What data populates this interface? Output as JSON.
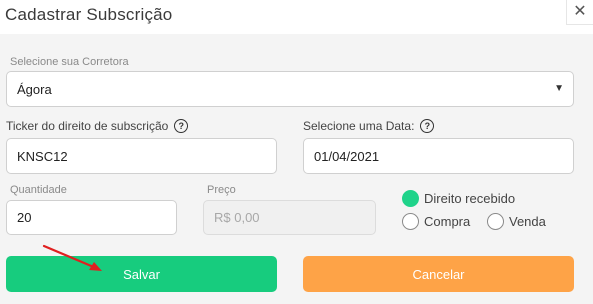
{
  "modal": {
    "title": "Cadastrar Subscrição",
    "close_icon": "close-icon"
  },
  "broker": {
    "label": "Selecione sua Corretora",
    "value": "Ágora"
  },
  "ticker": {
    "label": "Ticker do direito de subscrição",
    "value": "KNSC12"
  },
  "date": {
    "label": "Selecione uma Data:",
    "value": "01/04/2021"
  },
  "quantity": {
    "label": "Quantidade",
    "value": "20"
  },
  "price": {
    "label": "Preço",
    "placeholder": "R$ 0,00"
  },
  "radios": {
    "received": "Direito recebido",
    "buy": "Compra",
    "sell": "Venda",
    "selected": "received"
  },
  "buttons": {
    "save": "Salvar",
    "cancel": "Cancelar"
  },
  "colors": {
    "save": "#17cc7e",
    "cancel": "#fea347",
    "radio_checked": "#1fd38a",
    "annotation_arrow": "#e02020"
  }
}
